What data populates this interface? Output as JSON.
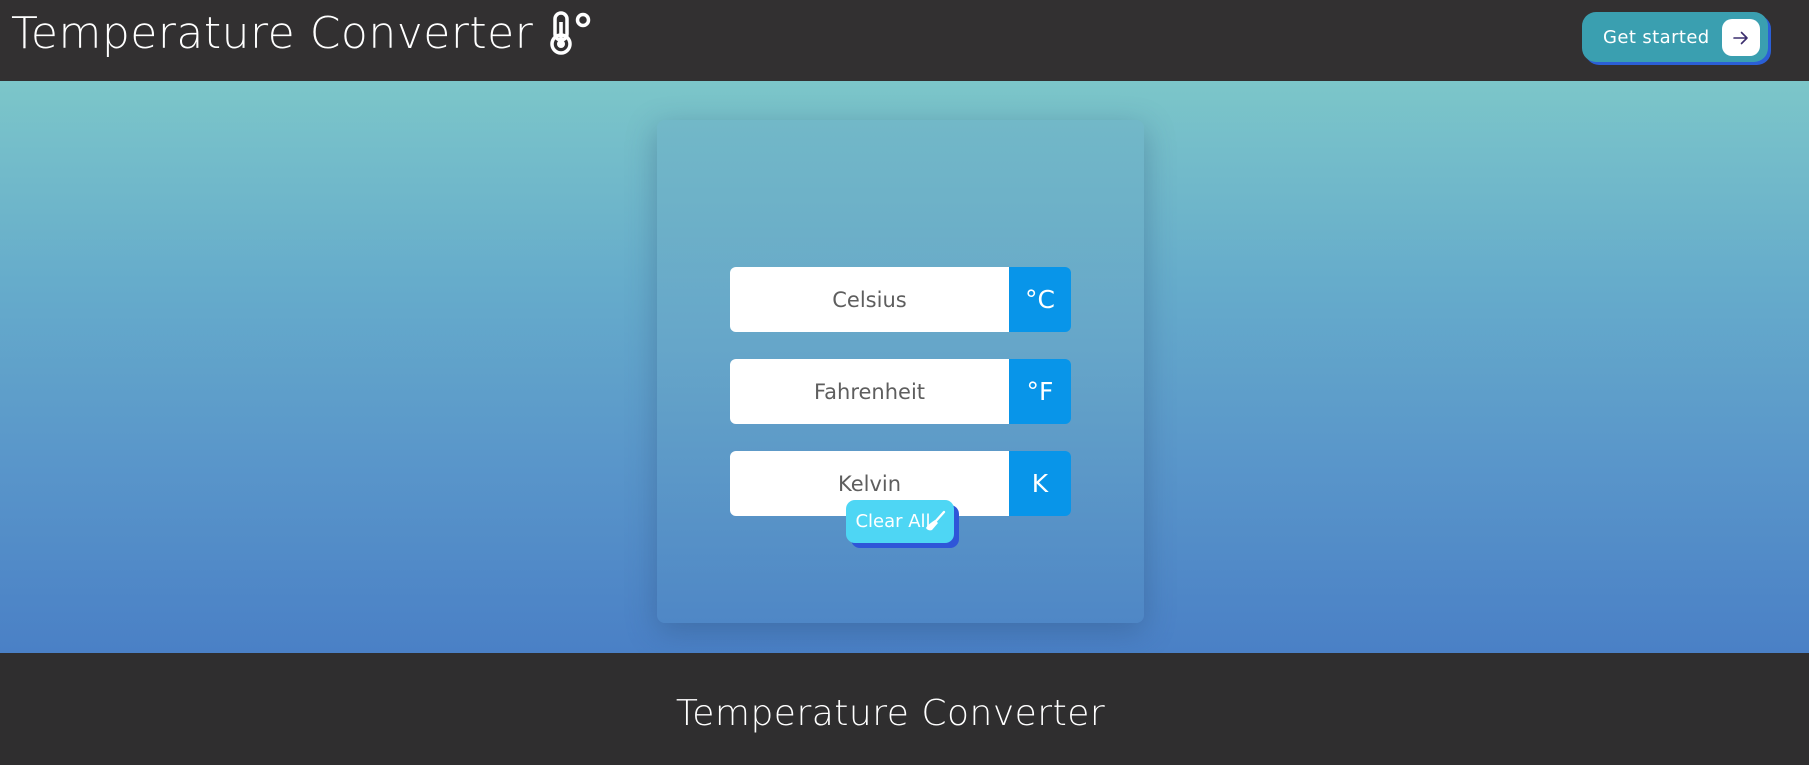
{
  "header": {
    "title": "Temperature Converter",
    "cta_label": "Get started"
  },
  "converter": {
    "celsius": {
      "placeholder": "Celsius",
      "value": "",
      "unit": "°C"
    },
    "fahrenheit": {
      "placeholder": "Fahrenheit",
      "value": "",
      "unit": "°F"
    },
    "kelvin": {
      "placeholder": "Kelvin",
      "value": "",
      "unit": "K"
    },
    "clear_label": "Clear All"
  },
  "footer": {
    "title": "Temperature Converter"
  },
  "icons": {
    "title_icon": "thermometer-degree-icon",
    "cta_icon": "arrow-right-icon",
    "clear_icon": "broom-icon"
  },
  "colors": {
    "header_bg": "#323031",
    "unit_bg": "#0895e9",
    "cta_bg": "#3a9fb0",
    "clear_bg": "#4ed6f4",
    "accent_shadow": "#2f56d8"
  }
}
